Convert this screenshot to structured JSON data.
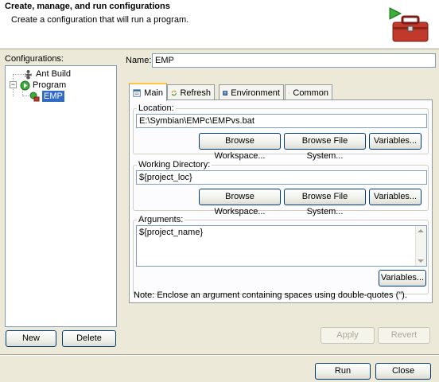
{
  "header": {
    "title": "Create, manage, and run configurations",
    "subtitle": "Create a configuration that will run a program."
  },
  "configurations": {
    "label": "Configurations:",
    "items": [
      {
        "label": "Ant Build",
        "icon": "ant-icon"
      },
      {
        "label": "Program",
        "icon": "program-icon"
      },
      {
        "label": "EMP",
        "icon": "program-config-icon"
      }
    ]
  },
  "left_buttons": {
    "new": "New",
    "delete": "Delete"
  },
  "name": {
    "label": "Name:",
    "value": "EMP"
  },
  "tabs": [
    {
      "label": "Main",
      "icon": "main-tab-icon"
    },
    {
      "label": "Refresh",
      "icon": "refresh-icon"
    },
    {
      "label": "Environment",
      "icon": "environment-icon"
    },
    {
      "label": "Common",
      "icon": "common-icon"
    }
  ],
  "location": {
    "label": "Location:",
    "value": "E:\\Symbian\\EMPc\\EMPvs.bat",
    "browse_workspace": "Browse Workspace...",
    "browse_fs": "Browse File System...",
    "variables": "Variables..."
  },
  "working_dir": {
    "label": "Working Directory:",
    "value": "${project_loc}",
    "browse_workspace": "Browse Workspace...",
    "browse_fs": "Browse File System...",
    "variables": "Variables..."
  },
  "arguments": {
    "label": "Arguments:",
    "value": "${project_name}",
    "variables": "Variables..."
  },
  "note": "Note: Enclose an argument containing spaces using double-quotes (\").",
  "actions": {
    "apply": "Apply",
    "revert": "Revert",
    "run": "Run",
    "close": "Close"
  }
}
